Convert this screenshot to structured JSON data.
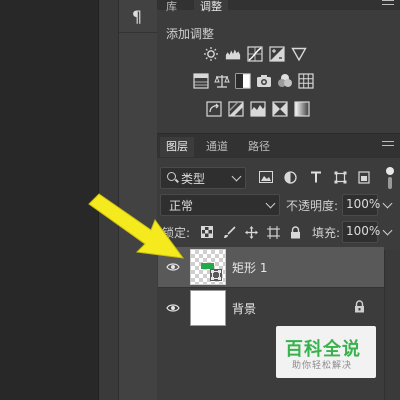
{
  "left_toolbar": {
    "character_icon": "¶"
  },
  "top_tabs": [
    {
      "label": "库"
    },
    {
      "label": "调整",
      "active": true
    }
  ],
  "adjustments": {
    "title": "添加调整",
    "row1": [
      "brightness-contrast-icon",
      "levels-icon",
      "curves-icon",
      "exposure-icon",
      "vibrance-icon"
    ],
    "row2": [
      "hue-saturation-icon",
      "color-balance-icon",
      "black-white-icon",
      "photo-filter-icon",
      "channel-mixer-icon",
      "color-lookup-icon"
    ],
    "row3": [
      "invert-icon",
      "posterize-icon",
      "threshold-icon",
      "selective-color-icon",
      "gradient-map-icon"
    ]
  },
  "layers_panel": {
    "tabs": [
      {
        "label": "图层",
        "active": true
      },
      {
        "label": "通道"
      },
      {
        "label": "路径"
      }
    ],
    "filter": {
      "label": "类型"
    },
    "filter_icons": [
      "image-filter-icon",
      "adjustment-filter-icon",
      "type-filter-icon",
      "shape-filter-icon",
      "smart-object-filter-icon"
    ],
    "blend_mode": "正常",
    "opacity_label": "不透明度:",
    "opacity_value": "100%",
    "lock_label": "锁定:",
    "lock_icons": [
      "lock-transparent-icon",
      "lock-image-icon",
      "lock-position-icon",
      "lock-artboard-icon",
      "lock-all-icon"
    ],
    "fill_label": "填充:",
    "fill_value": "100%",
    "layers": [
      {
        "name": "矩形 1",
        "selected": true,
        "visible": true,
        "thumb": "transparent-with-green-rect",
        "shape_color": "#23a84a"
      },
      {
        "name": "背景",
        "selected": false,
        "visible": true,
        "thumb": "white",
        "locked": true
      }
    ]
  },
  "watermark": {
    "main": "百科全说",
    "sub": "助你轻松解决"
  },
  "colors": {
    "accent_green": "#23a84a",
    "arrow_yellow": "#f4ea1d"
  }
}
